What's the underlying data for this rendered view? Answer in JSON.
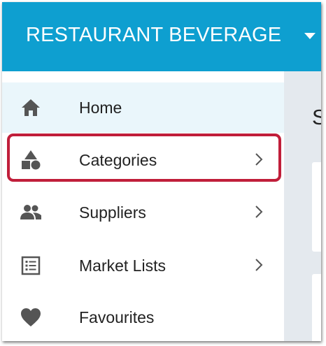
{
  "header": {
    "title": "RESTAURANT BEVERAGE",
    "caret_icon": "caret-down-icon"
  },
  "sidebar": {
    "items": [
      {
        "label": "Home",
        "icon": "home-icon",
        "has_chevron": false,
        "active": true
      },
      {
        "label": "Categories",
        "icon": "shapes-icon",
        "has_chevron": true,
        "highlighted": true
      },
      {
        "label": "Suppliers",
        "icon": "people-icon",
        "has_chevron": true
      },
      {
        "label": "Market Lists",
        "icon": "list-icon",
        "has_chevron": true
      },
      {
        "label": "Favourites",
        "icon": "heart-icon",
        "has_chevron": false
      }
    ]
  },
  "content": {
    "heading_partial": "S"
  },
  "colors": {
    "header_bg": "#0e9fd0",
    "active_item_bg": "#eaf6fb",
    "highlight_border": "#c01e3a",
    "icon_color": "#555555",
    "content_bg": "#e4e9ee"
  }
}
